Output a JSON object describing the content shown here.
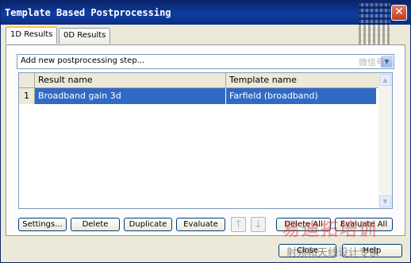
{
  "window": {
    "title": "Template Based Postprocessing",
    "close_glyph": "✕"
  },
  "tabs": [
    {
      "label": "1D Results",
      "active": true
    },
    {
      "label": "0D Results",
      "active": false
    }
  ],
  "step_select": {
    "value": "Add new postprocessing step...",
    "arrow": "▼"
  },
  "watermark": {
    "corner_text": "微信号:",
    "red_text": "易迪拓培训",
    "bottom_text": "射频和天线设计专家"
  },
  "table": {
    "columns": [
      "Result name",
      "Template name"
    ],
    "rows": [
      {
        "index": "1",
        "result_name": "Broadband gain 3d",
        "template_name": "Farfield (broadband)"
      }
    ],
    "scroll_up": "▲",
    "scroll_down": "▼"
  },
  "buttons": {
    "settings": "Settings...",
    "delete": "Delete",
    "duplicate": "Duplicate",
    "evaluate": "Evaluate",
    "move_up": "🡑",
    "move_down": "🡓",
    "delete_all": "Delete All",
    "evaluate_all": "Evaluate All",
    "close": "Close",
    "help": "Help"
  },
  "colors": {
    "title_bar": "#0a246a",
    "selection": "#316ac5",
    "close_button": "#c2391d",
    "active_tab_accent": "#ffc83c"
  }
}
